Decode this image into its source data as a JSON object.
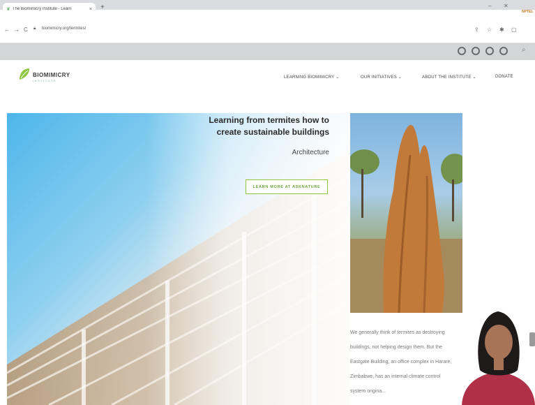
{
  "browser": {
    "tab_title": "The Biomimicry Institute - Learn",
    "tab_close": "×",
    "new_tab": "+",
    "back": "←",
    "forward": "→",
    "reload": "C",
    "url": "biomimicry.org/termites/",
    "window_minimize": "‒",
    "window_close": "✕"
  },
  "social_icons": [
    "facebook-icon",
    "instagram-icon",
    "pinterest-icon",
    "twitter-icon"
  ],
  "site": {
    "logo_name": "BIOMIMICRY",
    "logo_sub": "INSTITUTE",
    "nav": [
      {
        "label": "LEARNING BIOMIMICRY ⌄"
      },
      {
        "label": "OUR INITIATIVES ⌄"
      },
      {
        "label": "ABOUT THE INSTITUTE ⌄"
      },
      {
        "label": "DONATE"
      }
    ]
  },
  "hero": {
    "title_line1": "Learning from termites how to",
    "title_line2": "create sustainable buildings",
    "category": "Architecture",
    "cta_label": "LEARN MORE AT ASKNATURE"
  },
  "article": {
    "text": "We generally think of termites as destroying buildings, not helping design them. But the Eastgate Building, an office complex in Harare, Zimbabwe, has an internal climate control system origina..."
  },
  "overlay": {
    "logo_text": "NPTEL"
  },
  "colors": {
    "accent_green": "#8dc63f",
    "sky_blue": "#4eb6ea"
  }
}
